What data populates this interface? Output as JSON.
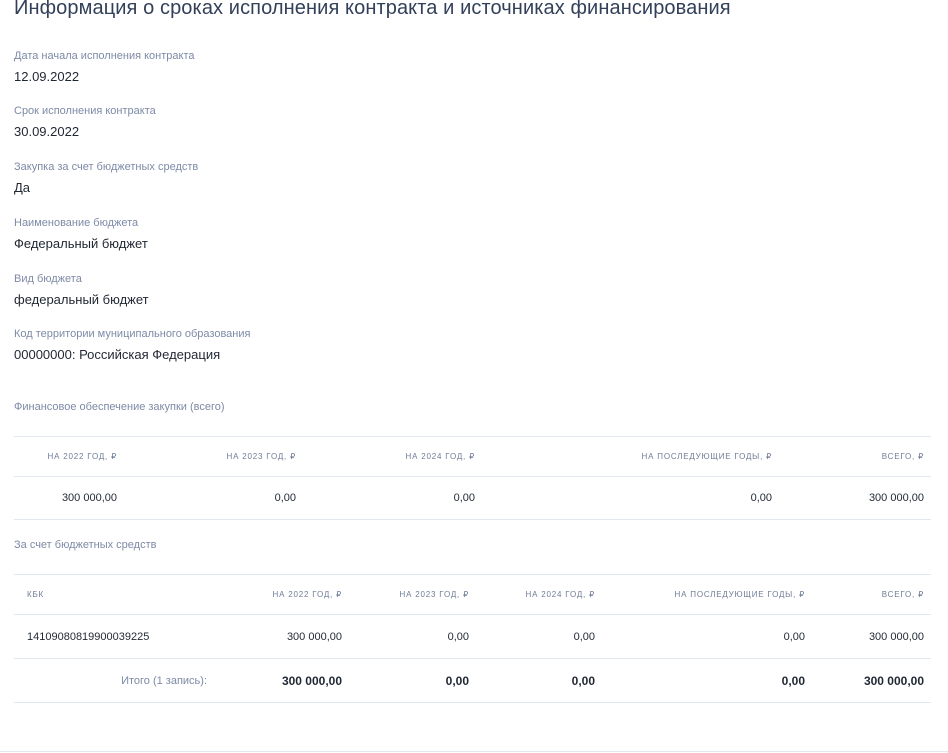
{
  "page": {
    "title": "Информация о сроках исполнения контракта и источниках финансирования"
  },
  "fields": [
    {
      "label": "Дата начала исполнения контракта",
      "value": "12.09.2022"
    },
    {
      "label": "Срок исполнения контракта",
      "value": "30.09.2022"
    },
    {
      "label": "Закупка за счет бюджетных средств",
      "value": "Да"
    },
    {
      "label": "Наименование бюджета",
      "value": "Федеральный бюджет"
    },
    {
      "label": "Вид бюджета",
      "value": "федеральный бюджет"
    },
    {
      "label": "Код территории муниципального образования",
      "value": "00000000: Российская Федерация"
    }
  ],
  "financing": {
    "section_label": "Финансовое обеспечение закупки (всего)",
    "headers": [
      "НА 2022 ГОД, ₽",
      "НА 2023 ГОД, ₽",
      "НА 2024 ГОД, ₽",
      "НА ПОСЛЕДУЮЩИЕ ГОДЫ, ₽",
      "ВСЕГО, ₽"
    ],
    "row": [
      "300 000,00",
      "0,00",
      "0,00",
      "0,00",
      "300 000,00"
    ]
  },
  "budget": {
    "section_label": "За счет бюджетных средств",
    "headers": [
      "КБК",
      "НА 2022 ГОД, ₽",
      "НА 2023 ГОД, ₽",
      "НА 2024 ГОД, ₽",
      "НА ПОСЛЕДУЮЩИЕ ГОДЫ, ₽",
      "ВСЕГО, ₽"
    ],
    "row": [
      "14109080819900039225",
      "300 000,00",
      "0,00",
      "0,00",
      "0,00",
      "300 000,00"
    ],
    "total": {
      "label": "Итого (1 запись):",
      "values": [
        "300 000,00",
        "0,00",
        "0,00",
        "0,00",
        "300 000,00"
      ]
    }
  }
}
